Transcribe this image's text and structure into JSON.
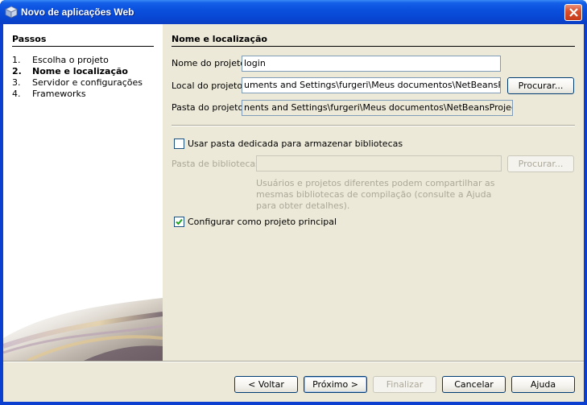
{
  "window": {
    "title": "Novo de aplicações Web"
  },
  "steps": {
    "title": "Passos",
    "items": [
      {
        "num": "1.",
        "label": "Escolha o projeto",
        "current": false
      },
      {
        "num": "2.",
        "label": "Nome e localização",
        "current": true
      },
      {
        "num": "3.",
        "label": "Servidor e configurações",
        "current": false
      },
      {
        "num": "4.",
        "label": "Frameworks",
        "current": false
      }
    ]
  },
  "form": {
    "section_title": "Nome e localização",
    "project_name_label": "Nome do projeto:",
    "project_name_value": "login",
    "project_location_label": "Local do projeto:",
    "project_location_value": "uments and Settings\\furgeri\\Meus documentos\\NetBeansProjects",
    "browse_label": "Procurar...",
    "project_folder_label": "Pasta do projeto:",
    "project_folder_value": "nents and Settings\\furgeri\\Meus documentos\\NetBeansProjects\\login",
    "dedicated_folder_label": "Usar pasta dedicada para armazenar bibliotecas",
    "dedicated_folder_checked": false,
    "libraries_folder_label": "Pasta de bibliotecas:",
    "libraries_folder_value": "",
    "libraries_browse_label": "Procurar...",
    "libraries_help": "Usuários e projetos diferentes podem compartilhar as mesmas bibliotecas de compilação (consulte a Ajuda para obter detalhes).",
    "main_project_label": "Configurar como projeto principal",
    "main_project_checked": true
  },
  "buttons": {
    "back": "< Voltar",
    "next": "Próximo >",
    "finish": "Finalizar",
    "cancel": "Cancelar",
    "help": "Ajuda"
  },
  "colors": {
    "title_bar": "#0a50de",
    "dialog_bg": "#ece9d8",
    "close_button": "#d8502e"
  },
  "icons": {
    "app": "netbeans-cube-icon",
    "close": "close-icon",
    "check": "checkmark-icon"
  }
}
